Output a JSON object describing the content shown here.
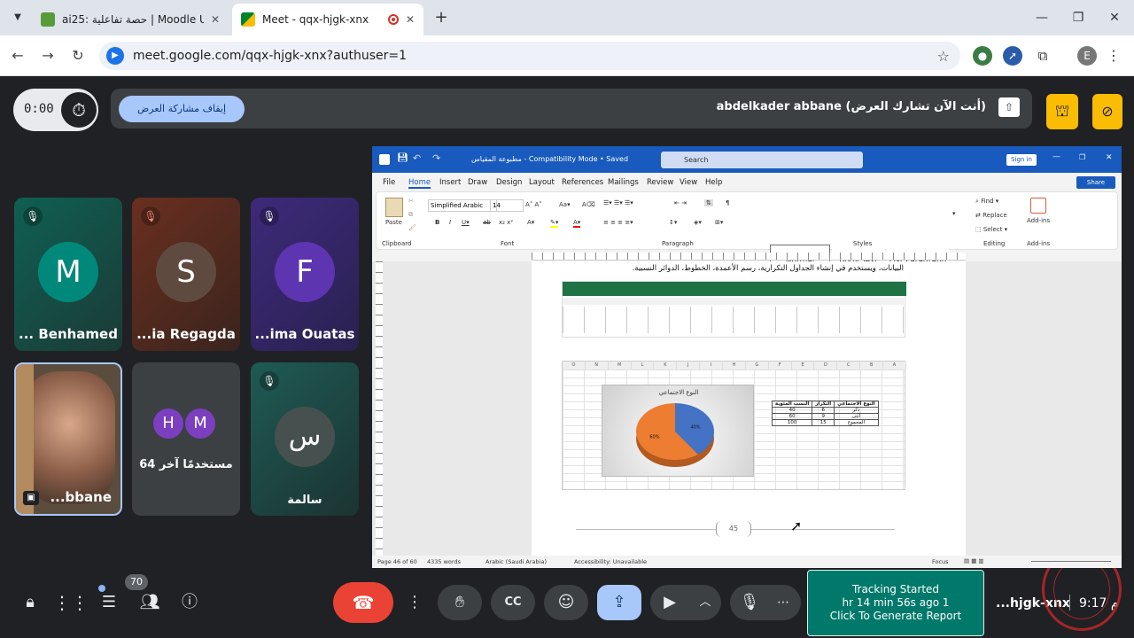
{
  "browser": {
    "tabs": [
      {
        "title": "ai25: حصة تفاعلية | Moodle UKM",
        "active": false
      },
      {
        "title": "Meet - qqx-hjgk-xnx",
        "active": true
      }
    ],
    "url": "meet.google.com/qqx-hjgk-xnx?authuser=1",
    "profile_initial": "E"
  },
  "meet": {
    "timer": "0:00",
    "stop_presenting_label": "إيقاف مشاركة العرض",
    "presenting_notice": "abdelkader abbane (أنت الآن تشارك العرض)",
    "participants": [
      {
        "initial": "M",
        "name": "... Benhamed"
      },
      {
        "initial": "S",
        "name": "...ia Regagda"
      },
      {
        "initial": "F",
        "name": "...ima Ouatas"
      },
      {
        "initial": "",
        "name": "...bbane"
      },
      {
        "initial": "H",
        "initial2": "M",
        "name": "64 مستخدمًا آخر"
      },
      {
        "initial": "س",
        "name": "سالمة"
      }
    ],
    "participant_count": "70",
    "meeting_code": "...hjgk-xnx",
    "time": "9:17 م",
    "tracking": {
      "line1": "Tracking Started",
      "line2": "hr 14 min 56s ago 1",
      "line3": "Click To Generate Report"
    }
  },
  "word": {
    "title": "مطبوعة المقياس  -  Compatibility Mode  •  Saved",
    "search_placeholder": "Search",
    "sign_in": "Sign in",
    "share": "Share",
    "menu": [
      "File",
      "Home",
      "Insert",
      "Draw",
      "Design",
      "Layout",
      "References",
      "Mailings",
      "Review",
      "View",
      "Help"
    ],
    "font_name": "Simplified Arabic",
    "font_size": "14",
    "styles": [
      "Normal",
      "Body Text",
      "List Paragraph"
    ],
    "editing": [
      "Find",
      "Replace",
      "Select"
    ],
    "addins": "Add-ins",
    "group_labels": [
      "Clipboard",
      "Font",
      "Paragraph",
      "Styles",
      "Editing",
      "Add-ins"
    ],
    "paste": "Paste",
    "body_text": "البيانات، ويستخدم في إنشاء الجداول التكرارية، رسم الأعمدة، الخطوط، الدوائر النسبية.",
    "page_number": "45",
    "status": {
      "page": "Page 46 of 60",
      "words": "4335 words",
      "language": "Arabic (Saudi Arabia)",
      "accessibility": "Accessibility: Unavailable",
      "focus": "Focus"
    },
    "excel": {
      "columns": [
        "O",
        "N",
        "M",
        "L",
        "K",
        "J",
        "I",
        "H",
        "G",
        "F",
        "E",
        "D",
        "C",
        "B",
        "A"
      ],
      "chart_title": "النوع الاجتماعي",
      "table_headers": [
        "النسب المئوية",
        "التكرار",
        "النوع الاجتماعي"
      ],
      "table_rows": [
        [
          "40",
          "6",
          "ذكر"
        ],
        [
          "60",
          "9",
          "أنثى"
        ],
        [
          "100",
          "15",
          "المجموع"
        ]
      ],
      "pie_labels": [
        "40%",
        "60%"
      ]
    }
  },
  "chart_data": {
    "type": "pie",
    "title": "النوع الاجتماعي",
    "categories": [
      "ذكر",
      "أنثى"
    ],
    "values": [
      40,
      60
    ],
    "colors": [
      "#4472c4",
      "#ed7d31"
    ]
  }
}
